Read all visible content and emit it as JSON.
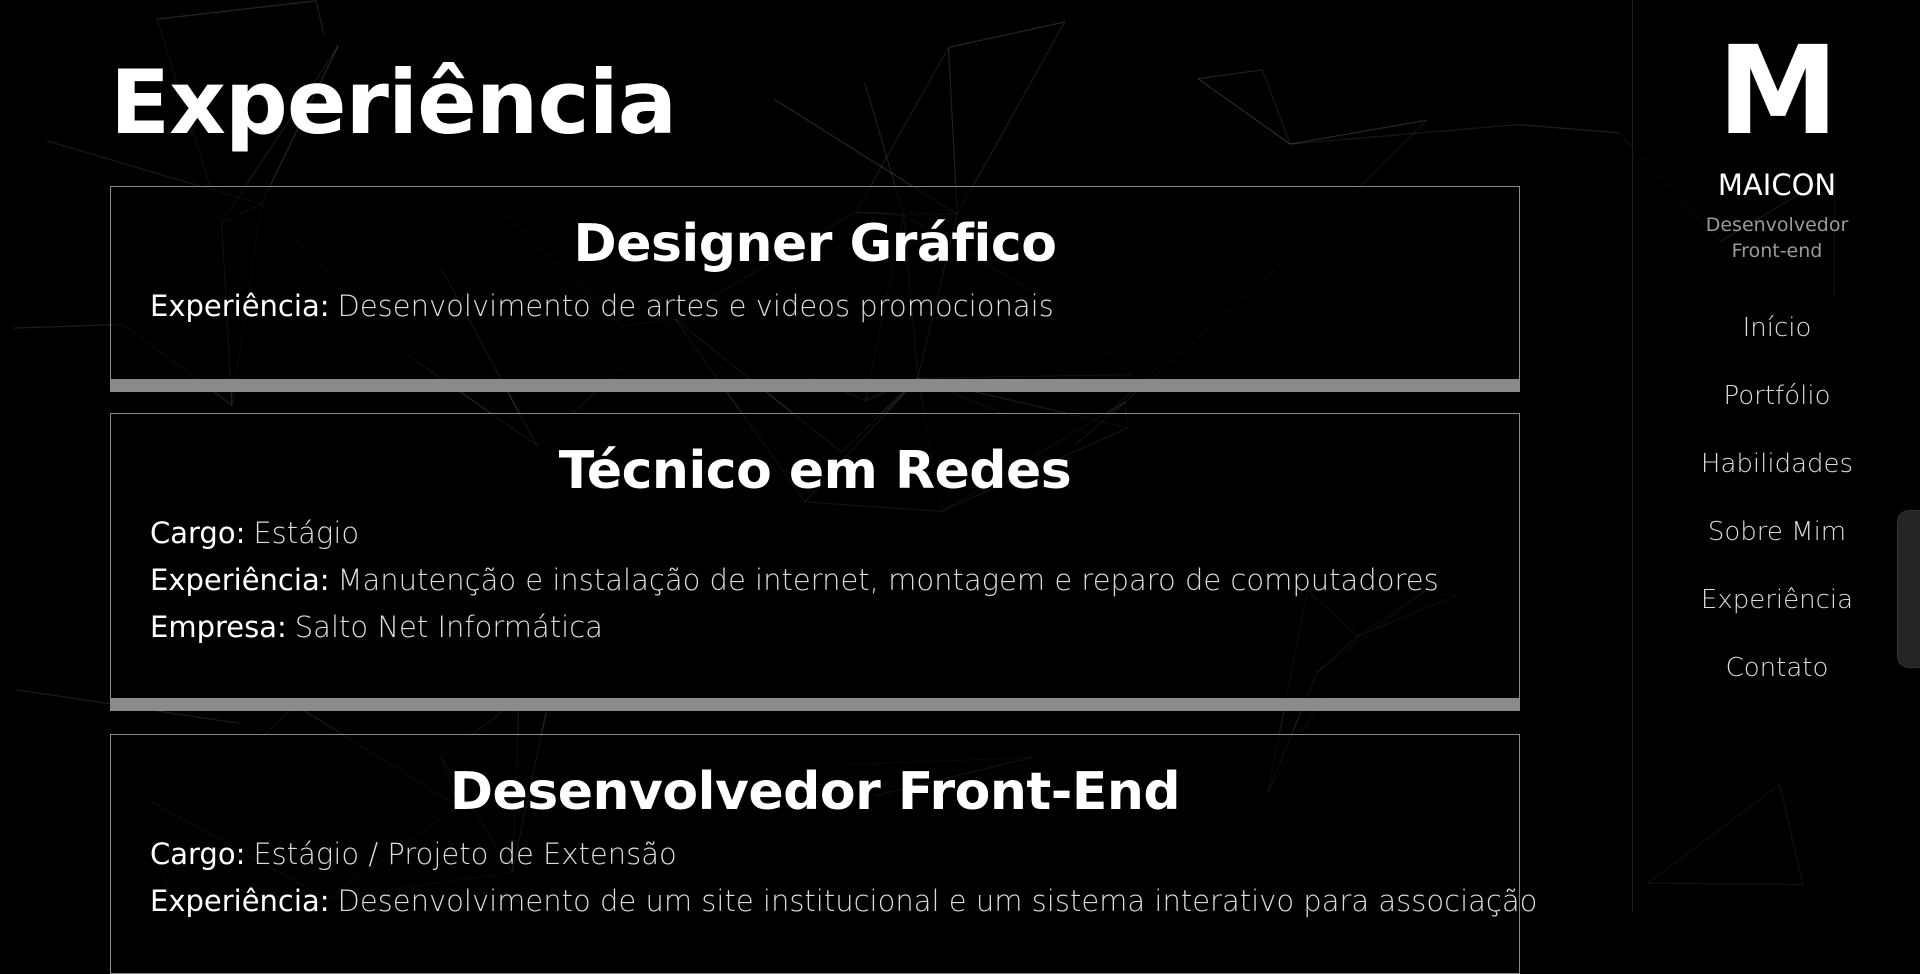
{
  "page": {
    "title": "Experiência"
  },
  "experiences": [
    {
      "title": "Designer Gráfico",
      "fields": [
        {
          "label": "Experiência:",
          "value": "Desenvolvimento de artes e videos promocionais"
        }
      ]
    },
    {
      "title": "Técnico em Redes",
      "fields": [
        {
          "label": "Cargo:",
          "value": "Estágio"
        },
        {
          "label": "Experiência:",
          "value": "Manutenção e instalação de internet, montagem e reparo de computadores"
        },
        {
          "label": "Empresa:",
          "value": "Salto Net Informática"
        }
      ]
    },
    {
      "title": "Desenvolvedor Front-End",
      "fields": [
        {
          "label": "Cargo:",
          "value": "Estágio / Projeto de Extensão"
        },
        {
          "label": "Experiência:",
          "value": "Desenvolvimento de um site institucional e um sistema interativo para associação"
        }
      ]
    }
  ],
  "sidebar": {
    "logo_letter": "M",
    "name": "MAICON",
    "subtitle_line1": "Desenvolvedor",
    "subtitle_line2": "Front-end",
    "nav": [
      "Início",
      "Portfólio",
      "Habilidades",
      "Sobre Mim",
      "Experiência",
      "Contato"
    ]
  },
  "colors": {
    "background": "#000000",
    "text": "#ffffff",
    "muted": "#9a9a9a",
    "card_border": "#8a8a8a",
    "bar": "#8a8a8a"
  }
}
